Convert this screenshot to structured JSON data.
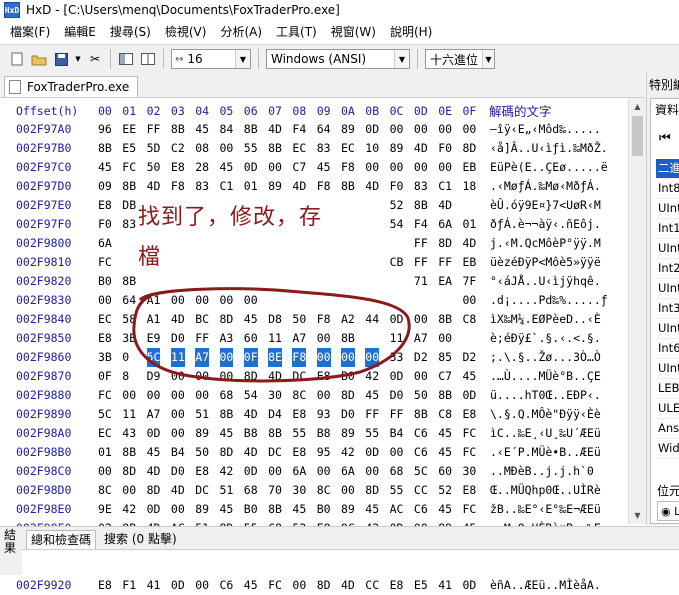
{
  "window": {
    "title": "HxD - [C:\\Users\\menq\\Documents\\FoxTraderPro.exe]"
  },
  "menu": [
    "檔案(F)",
    "編輯E",
    "搜尋(S)",
    "檢視(V)",
    "分析(A)",
    "工具(T)",
    "視窗(W)",
    "說明(H)"
  ],
  "toolbar": {
    "columns": "16",
    "charset": "Windows (ANSI)",
    "base": "十六進位"
  },
  "tab": {
    "label": "FoxTraderPro.exe"
  },
  "hex": {
    "offset_label": "Offset(h)",
    "columns": [
      "00",
      "01",
      "02",
      "03",
      "04",
      "05",
      "06",
      "07",
      "08",
      "09",
      "0A",
      "0B",
      "0C",
      "0D",
      "0E",
      "0F"
    ],
    "text_label": "解碼的文字",
    "rows": [
      {
        "off": "002F97A0",
        "bytes": [
          "96",
          "EE",
          "FF",
          "8B",
          "45",
          "84",
          "8B",
          "4D",
          "F4",
          "64",
          "89",
          "0D",
          "00",
          "00",
          "00",
          "00"
        ],
        "text": "–îÿ‹E„‹Môd‰....."
      },
      {
        "off": "002F97B0",
        "bytes": [
          "8B",
          "E5",
          "5D",
          "C2",
          "08",
          "00",
          "55",
          "8B",
          "EC",
          "83",
          "EC",
          "10",
          "89",
          "4D",
          "F0",
          "8D"
        ],
        "text": "‹å]Â..U‹ìƒì.‰MðŽ."
      },
      {
        "off": "002F97C0",
        "bytes": [
          "45",
          "FC",
          "50",
          "E8",
          "28",
          "45",
          "0D",
          "00",
          "C7",
          "45",
          "F8",
          "00",
          "00",
          "00",
          "00",
          "EB"
        ],
        "text": "EüPè(E..ÇEø.....ë"
      },
      {
        "off": "002F97D0",
        "bytes": [
          "09",
          "8B",
          "4D",
          "F8",
          "83",
          "C1",
          "01",
          "89",
          "4D",
          "F8",
          "8B",
          "4D",
          "F0",
          "83",
          "C1",
          "18"
        ],
        "text": ".‹MøƒÁ.‰Mø‹MðƒÁ."
      },
      {
        "off": "002F97E0",
        "bytes": [
          "E8",
          "DB",
          "",
          "",
          "",
          "",
          "45",
          "7D",
          "37",
          "0F",
          "55",
          "F8",
          "52",
          "8B",
          "4D",
          "",
          "",
          ""
        ],
        "text": "èÛ.óÿ9E¤}7<UøR‹M"
      },
      {
        "off": "002F97F0",
        "bytes": [
          "F0",
          "83",
          "",
          "",
          "",
          "",
          "",
          "",
          "",
          "",
          "",
          "",
          "54",
          "F4",
          "6A",
          "01"
        ],
        "text": "ðƒÁ.è¬¬àÿ‹.ñEôj."
      },
      {
        "off": "002F9800",
        "bytes": [
          "6A",
          "",
          "",
          "",
          "",
          "",
          "",
          "",
          "",
          "",
          "",
          "",
          "",
          "FF",
          "8D",
          "4D"
        ],
        "text": "j.‹M.QcMôèP°ÿÿ.M"
      },
      {
        "off": "002F9810",
        "bytes": [
          "FC",
          "",
          "",
          "",
          "",
          "",
          "",
          "",
          "",
          "",
          "",
          "",
          "CB",
          "FF",
          "FF",
          "EB"
        ],
        "text": "üèzéÐÿP<Môè5»ÿÿë"
      },
      {
        "off": "002F9820",
        "bytes": [
          "B0",
          "8B",
          "",
          "",
          "",
          "",
          "",
          "",
          "",
          "",
          "",
          "",
          "",
          "71",
          "EA",
          "7F"
        ],
        "text": "°‹áJÅ..U‹ìjÿhqê."
      },
      {
        "off": "002F9830",
        "bytes": [
          "00",
          "64",
          "A1",
          "00",
          "00",
          "00",
          "00",
          "",
          "",
          "",
          "",
          "",
          "",
          "",
          "",
          "00"
        ],
        "text": ".d¡....Pd‰%.....ƒ"
      },
      {
        "off": "002F9840",
        "bytes": [
          "EC",
          "58",
          "A1",
          "4D",
          "BC",
          "8D",
          "45",
          "D8",
          "50",
          "F8",
          "A2",
          "44",
          "0D",
          "00",
          "8B",
          "C8"
        ],
        "text": "ìX‰M¼.EØPèeD..‹È"
      },
      {
        "off": "002F9850",
        "bytes": [
          "E8",
          "3B",
          "E9",
          "D0",
          "FF",
          "A3",
          "60",
          "11",
          "A7",
          "00",
          "8B",
          "",
          "11",
          "A7",
          "00"
        ],
        "text": "è;éÐÿ£`.§.‹.<.§."
      },
      {
        "off": "002F9860",
        "bytes": [
          "3B",
          "0",
          "5C",
          "11",
          "A7",
          "00",
          "0F",
          "8E",
          "F8",
          "00",
          "00",
          "00",
          "33",
          "D2",
          "85",
          "D2"
        ],
        "text": ";.\\.§..Žø...3Ò…Ò"
      },
      {
        "off": "002F9870",
        "bytes": [
          "0F",
          "8",
          "D9",
          "00",
          "00",
          "00",
          "8D",
          "4D",
          "DC",
          "E8",
          "B0",
          "42",
          "0D",
          "00",
          "C7",
          "45"
        ],
        "text": ".…Ù....MÜè°B..ÇE"
      },
      {
        "off": "002F9880",
        "bytes": [
          "FC",
          "00",
          "00",
          "00",
          "00",
          "68",
          "54",
          "30",
          "8C",
          "00",
          "8D",
          "45",
          "D0",
          "50",
          "8B",
          "0D"
        ],
        "text": "ü....hT0Œ..EÐP‹."
      },
      {
        "off": "002F9890",
        "bytes": [
          "5C",
          "11",
          "A7",
          "00",
          "51",
          "8B",
          "4D",
          "D4",
          "E8",
          "93",
          "D0",
          "FF",
          "FF",
          "8B",
          "C8",
          "E8"
        ],
        "text": "\\.§.Q.MÔè\"Ðÿÿ‹Èè"
      },
      {
        "off": "002F98A0",
        "bytes": [
          "EC",
          "43",
          "0D",
          "00",
          "89",
          "45",
          "B8",
          "8B",
          "55",
          "B8",
          "89",
          "55",
          "B4",
          "C6",
          "45",
          "FC"
        ],
        "text": "ìC..‰E¸‹U¸‰U´ÆEü"
      },
      {
        "off": "002F98B0",
        "bytes": [
          "01",
          "8B",
          "45",
          "B4",
          "50",
          "8D",
          "4D",
          "DC",
          "E8",
          "95",
          "42",
          "0D",
          "00",
          "C6",
          "45",
          "FC"
        ],
        "text": ".‹E´P.MÜè•B..ÆEü"
      },
      {
        "off": "002F98C0",
        "bytes": [
          "00",
          "8D",
          "4D",
          "D0",
          "E8",
          "42",
          "0D",
          "00",
          "6A",
          "00",
          "6A",
          "00",
          "68",
          "5C",
          "60",
          "30"
        ],
        "text": "..MÐèB..j.j.h`0"
      },
      {
        "off": "002F98D0",
        "bytes": [
          "8C",
          "00",
          "8D",
          "4D",
          "DC",
          "51",
          "68",
          "70",
          "30",
          "8C",
          "00",
          "8D",
          "55",
          "CC",
          "52",
          "E8"
        ],
        "text": "Œ..MÜQhp0Œ..UÌRè"
      },
      {
        "off": "002F98E0",
        "bytes": [
          "9E",
          "42",
          "0D",
          "00",
          "89",
          "45",
          "B0",
          "8B",
          "45",
          "B0",
          "89",
          "45",
          "AC",
          "C6",
          "45",
          "FC"
        ],
        "text": "žB..‰E°‹E°‰E¬ÆEü"
      },
      {
        "off": "002F98F0",
        "bytes": [
          "02",
          "8B",
          "4D",
          "AC",
          "51",
          "8D",
          "55",
          "C8",
          "52",
          "E8",
          "9C",
          "42",
          "0D",
          "00",
          "89",
          "45"
        ],
        "text": ".‹M¬Q.UÈRèœB..‰E"
      },
      {
        "off": "002F9900",
        "bytes": [
          "A8",
          "8B",
          "45",
          "A8",
          "89",
          "45",
          "A4",
          "C6",
          "45",
          "FC",
          "03",
          "8B",
          "4D",
          "A4",
          "E8",
          "E8"
        ],
        "text": "¨‹E¨‰E¤ÆEü.‹M¤è."
      },
      {
        "off": "002F9910",
        "bytes": [
          "C2",
          "EE",
          "FF",
          "50",
          "E8",
          "42",
          "00",
          "00",
          "C6",
          "45",
          "FC",
          "02",
          "8D",
          "4D",
          "C8",
          "E8"
        ],
        "text": "ÂîÿPè.B..ÆEü..MÈè"
      },
      {
        "off": "002F9920",
        "bytes": [
          "E8",
          "F1",
          "41",
          "0D",
          "00",
          "C6",
          "45",
          "FC",
          "00",
          "8D",
          "4D",
          "CC",
          "E8",
          "E5",
          "41",
          "0D"
        ],
        "text": "èñA..ÆEü..MÌèåA."
      }
    ]
  },
  "data_inspector": {
    "title": "特別編",
    "tab": "資料",
    "items": [
      "二進",
      "Int8",
      "UInt",
      "Int16",
      "UInt",
      "Int24",
      "UInt",
      "Int32",
      "UInt",
      "Int64",
      "UInt",
      "LEB",
      "ULE",
      "Ansi",
      "Wid"
    ],
    "group": "位元",
    "radio": "L",
    "checkbox": "☐"
  },
  "bottom": {
    "vertical_label": "結果",
    "tabs": [
      "總和檢查碼",
      "搜索 (0 點擊)"
    ]
  },
  "annotation": {
    "line1": "找到了，修改，存",
    "line2": "檔",
    "color": "#8b1a1a"
  }
}
